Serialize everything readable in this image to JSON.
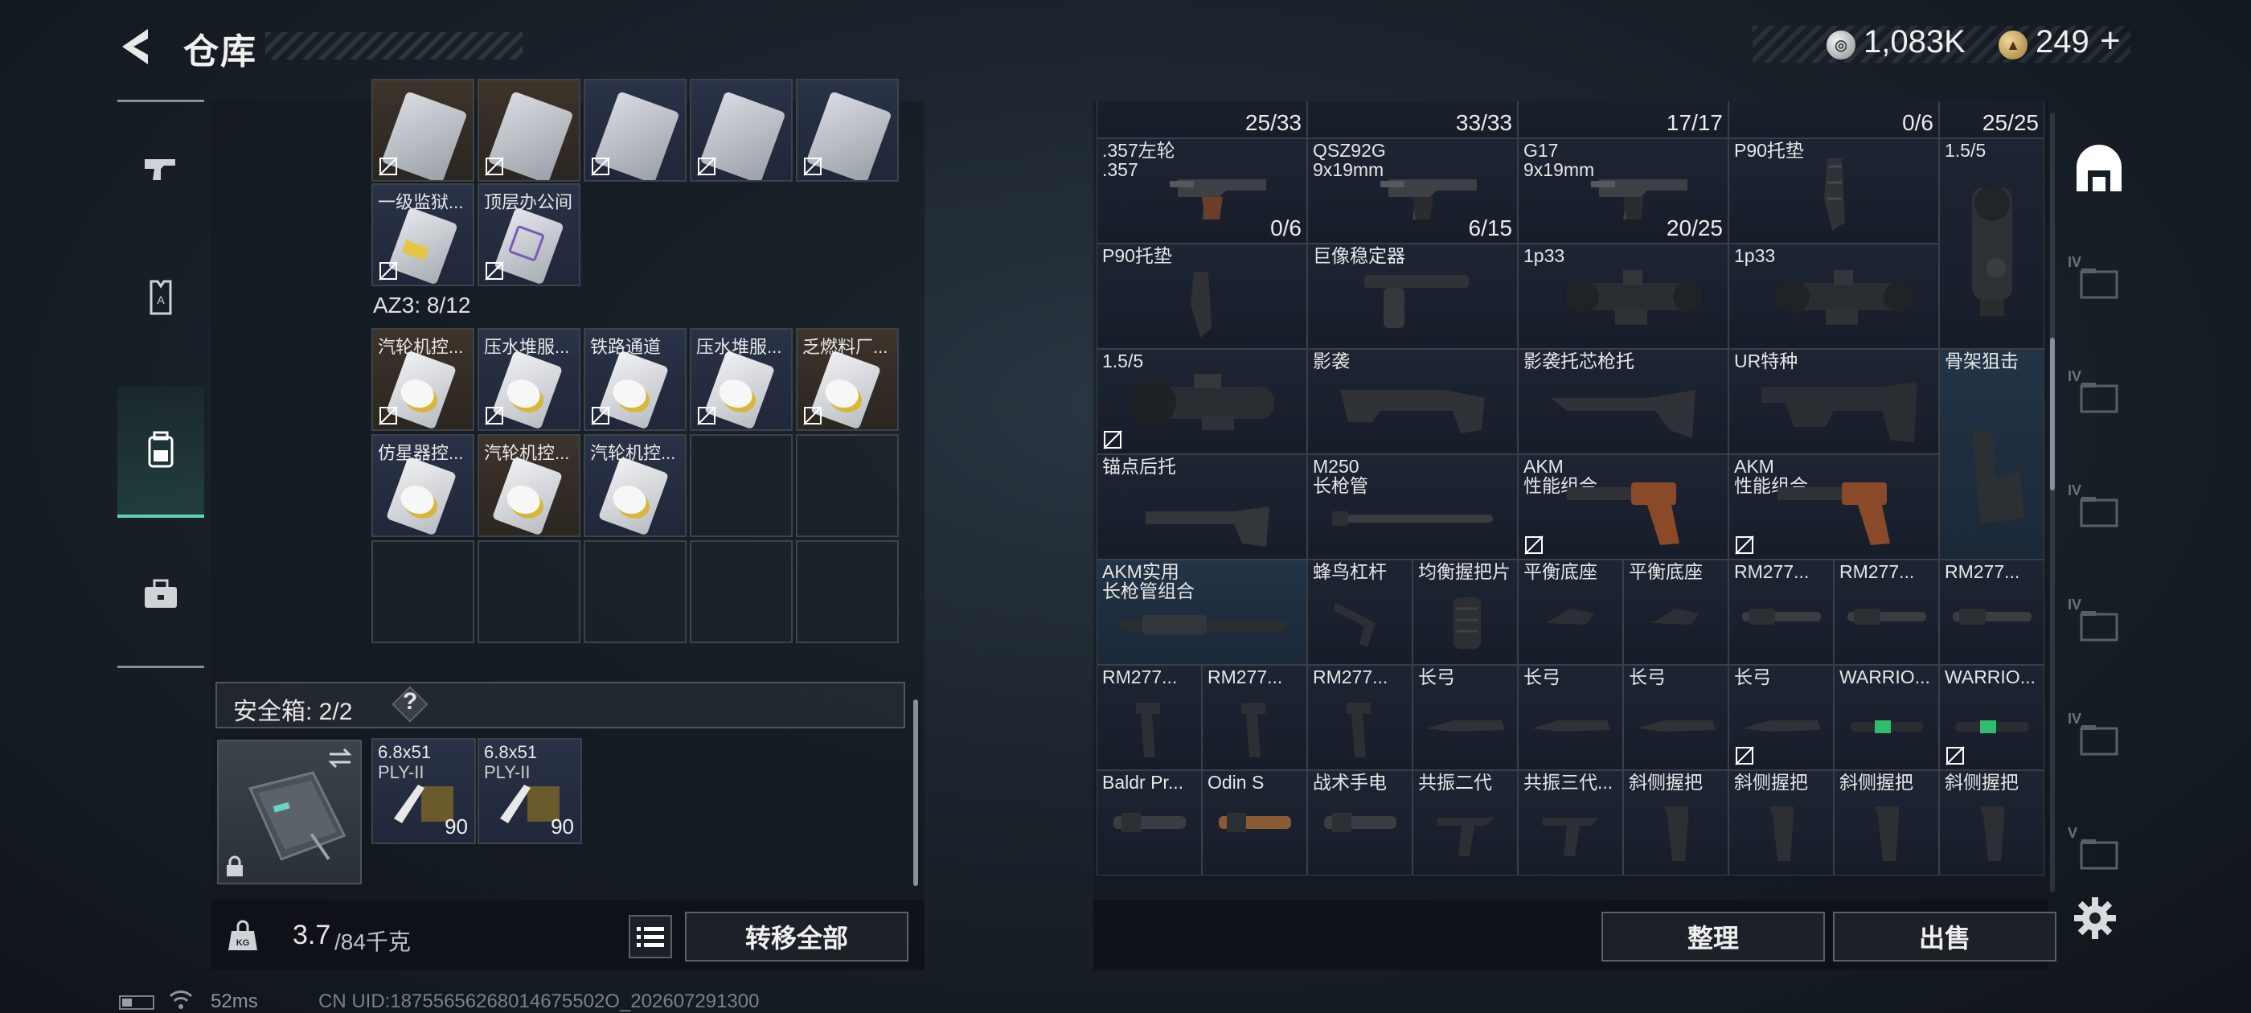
{
  "header": {
    "title": "仓库"
  },
  "currency": {
    "silver": "1,083K",
    "gold": "249",
    "plus": "+"
  },
  "left_sidebar": {
    "tabs": [
      "weapon",
      "armor",
      "backpack",
      "toolbox"
    ],
    "active": "backpack"
  },
  "left_panel": {
    "top_row_cards": [
      "",
      "",
      "",
      "",
      ""
    ],
    "key_cards_row2": [
      "一级监狱...",
      "顶层办公间"
    ],
    "az3": {
      "label": "AZ3: 8/12"
    },
    "az3_items": [
      {
        "label": "汽轮机控...",
        "bg": "brown"
      },
      {
        "label": "压水堆服...",
        "bg": "navy"
      },
      {
        "label": "铁路通道",
        "bg": "navy"
      },
      {
        "label": "压水堆服...",
        "bg": "navy"
      },
      {
        "label": "乏燃料厂...",
        "bg": "brown"
      },
      {
        "label": "仿星器控...",
        "bg": "navy"
      },
      {
        "label": "汽轮机控...",
        "bg": "brown"
      },
      {
        "label": "汽轮机控...",
        "bg": "navy"
      }
    ],
    "safebox": {
      "label": "安全箱: 2/2",
      "help": "?",
      "items": [
        {
          "label": "6.8x51",
          "sub": "PLY-II",
          "count": "90"
        },
        {
          "label": "6.8x51",
          "sub": "PLY-II",
          "count": "90"
        }
      ]
    },
    "footer": {
      "weight": "3.7",
      "weight_max": "/84千克",
      "transfer_label": "转移全部"
    }
  },
  "status": {
    "ping": "52ms",
    "uid": "CN UID:18755656268014675502O_202607291300"
  },
  "right_panel": {
    "row0_counts": [
      "25/33",
      "33/33",
      "17/17",
      "0/6",
      "25/25"
    ],
    "weapons": [
      {
        "name": ".357左轮",
        "ammo": ".357",
        "count": "0/6"
      },
      {
        "name": "QSZ92G",
        "ammo": "9x19mm",
        "count": "6/15"
      },
      {
        "name": "G17",
        "ammo": "9x19mm",
        "count": "20/25"
      }
    ],
    "p90_pad_1": "P90托垫",
    "scope_big": "1.5/5",
    "row2": [
      "P90托垫",
      "巨像稳定器",
      "1p33",
      "1p33"
    ],
    "row3": [
      "1.5/5",
      "影袭",
      "影袭托芯枪托",
      "UR特种",
      "骨架狙击"
    ],
    "row4": [
      {
        "l1": "锚点后托",
        "l2": ""
      },
      {
        "l1": "M250",
        "l2": "长枪管"
      },
      {
        "l1": "AKM",
        "l2": "性能组合"
      },
      {
        "l1": "AKM",
        "l2": "性能组合"
      }
    ],
    "row5": [
      {
        "l1": "AKM实用",
        "l2": "长枪管组合"
      },
      {
        "l1": "蜂鸟杠杆",
        "l2": ""
      },
      {
        "l1": "均衡握把片",
        "l2": ""
      },
      {
        "l1": "平衡底座",
        "l2": ""
      },
      {
        "l1": "平衡底座",
        "l2": ""
      },
      {
        "l1": "RM277...",
        "l2": ""
      },
      {
        "l1": "RM277...",
        "l2": ""
      },
      {
        "l1": "RM277...",
        "l2": ""
      }
    ],
    "row6": [
      "RM277...",
      "RM277...",
      "RM277...",
      "长弓",
      "长弓",
      "长弓",
      "长弓",
      "WARRIO...",
      "WARRIO..."
    ],
    "row7": [
      "Baldr Pr...",
      "Odin S",
      "战术手电",
      "共振二代",
      "共振三代...",
      "斜侧握把",
      "斜侧握把",
      "斜侧握把",
      "斜侧握把"
    ],
    "footer": {
      "sort_label": "整理",
      "sell_label": "出售"
    }
  },
  "right_sidebar": {
    "tabs": [
      "storage-home",
      "IV",
      "IV",
      "IV",
      "IV",
      "IV",
      "V"
    ]
  },
  "colors": {
    "accent_teal": "#5fd3b8",
    "cell_brown": "#3d342b",
    "cell_navy": "#2a3247"
  }
}
